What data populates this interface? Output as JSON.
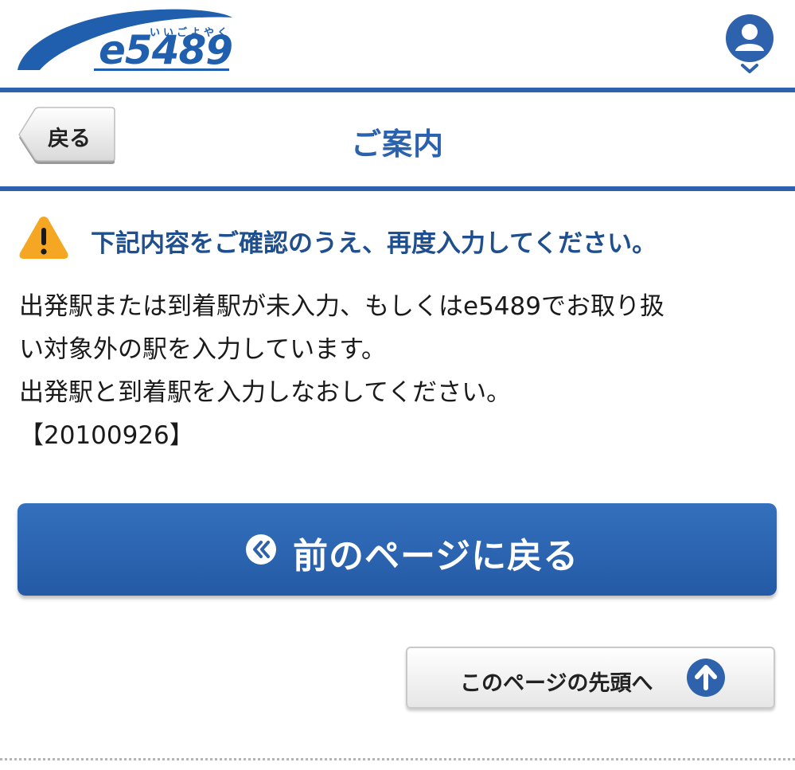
{
  "header": {
    "logo_ruby": "いいごよやく",
    "logo_text": "e5489",
    "account_icon": "user-account-icon",
    "dropdown_icon": "chevron-down-icon"
  },
  "titlebar": {
    "back_label": "戻る",
    "title": "ご案内"
  },
  "warning": {
    "icon": "warning-triangle-icon",
    "heading": "下記内容をご確認のうえ、再度入力してください。"
  },
  "message": {
    "line1": "出発駅または到着駅が未入力、もしくはe5489でお取り扱",
    "line2": "い対象外の駅を入力しています。",
    "line3": "出発駅と到着駅を入力しなおしてください。",
    "code": "【20100926】"
  },
  "actions": {
    "prev_page_label": "前のページに戻る",
    "prev_page_icon": "double-chevron-left-icon",
    "page_top_label": "このページの先頭へ",
    "page_top_icon": "arrow-up-circle-icon"
  },
  "colors": {
    "brand_blue": "#2f62ad",
    "warning_orange": "#f5a623",
    "title_blue": "#2b62ad"
  }
}
